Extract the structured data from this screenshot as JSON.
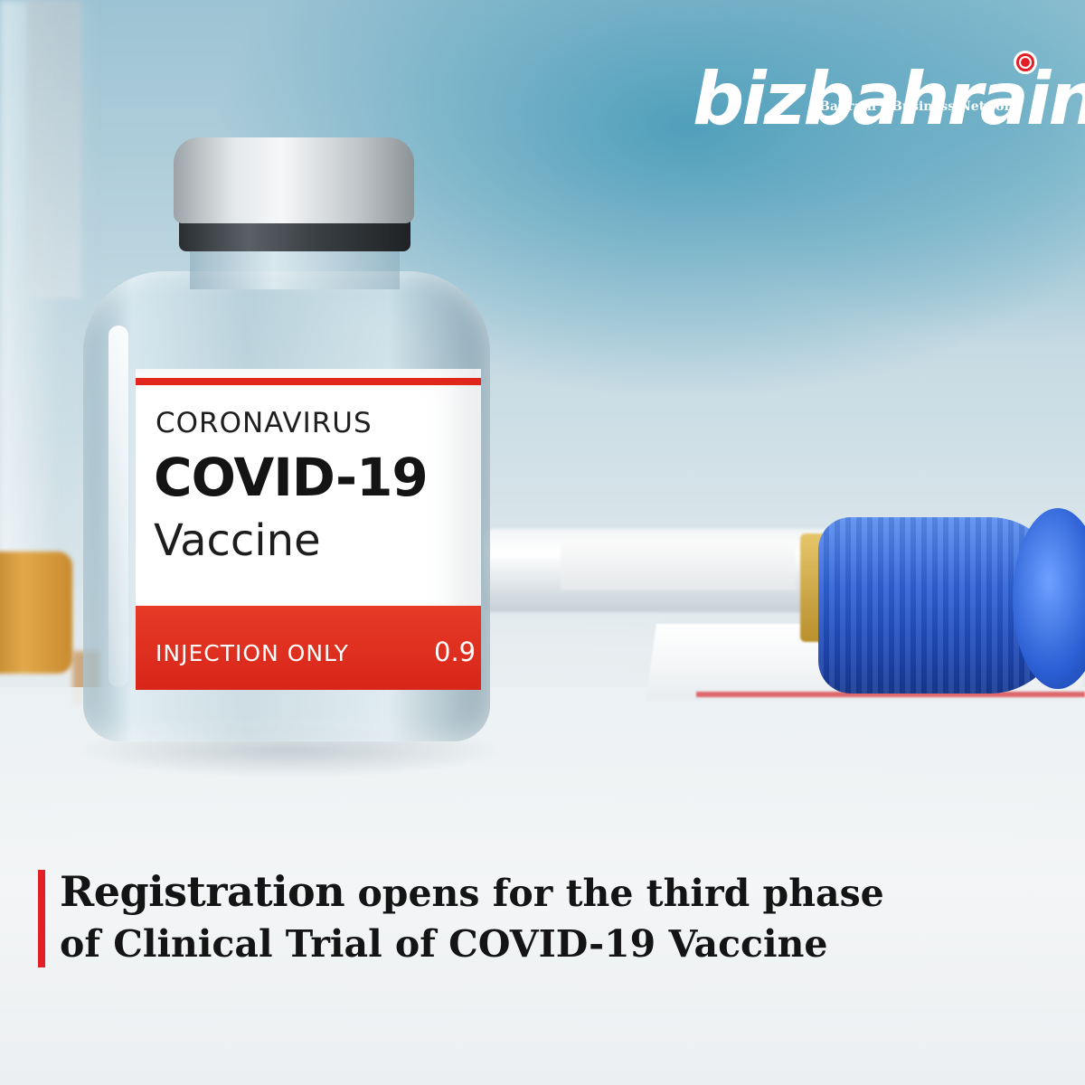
{
  "logo": {
    "wordmark": "bizbahrain",
    "tagline": "Bahrain's Business Network"
  },
  "vial_label": {
    "line1": "CORONAVIRUS",
    "line2": "COVID-19",
    "line3": "Vaccine",
    "band_text": "INJECTION ONLY",
    "band_number": "0.9"
  },
  "headline": {
    "lead": "Registration",
    "line1_rest": " opens for the third phase",
    "line2": "of Clinical Trial of COVID-19 Vaccine"
  },
  "colors": {
    "accent_red": "#e21f26",
    "text_dark": "#141414",
    "cap_blue": "#2f62d8"
  },
  "icons": {
    "logo_badge": "b-circle-icon"
  }
}
